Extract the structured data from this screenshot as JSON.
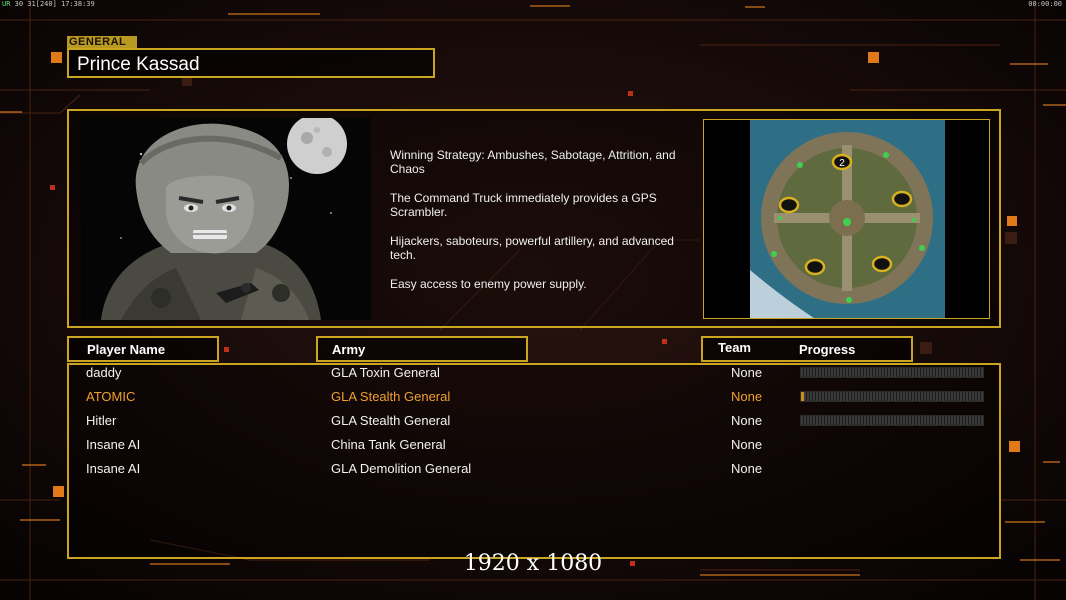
{
  "hud": {
    "left_prefix": "UR",
    "left_text": "30 31[240] 17:38:39",
    "right_text": "00:00:00"
  },
  "general": {
    "tag": "GENERAL",
    "name": "Prince Kassad",
    "description": [
      "Winning Strategy: Ambushes, Sabotage, Attrition, and Chaos",
      "The Command Truck immediately provides a GPS Scrambler.",
      "Hijackers, saboteurs, powerful artillery, and advanced tech.",
      "Easy access to enemy power supply."
    ]
  },
  "map": {
    "player_marker": "2"
  },
  "columns": {
    "player_name": "Player Name",
    "army": "Army",
    "team": "Team",
    "progress": "Progress"
  },
  "players": [
    {
      "name": "daddy",
      "army": "GLA Toxin General",
      "team": "None",
      "progress": 0.0,
      "show_bar": true,
      "highlight": false
    },
    {
      "name": "ATOMIC",
      "army": "GLA Stealth General",
      "team": "None",
      "progress": 0.01,
      "show_bar": true,
      "highlight": true
    },
    {
      "name": "Hitler",
      "army": "GLA Stealth General",
      "team": "None",
      "progress": 0.0,
      "show_bar": true,
      "highlight": false
    },
    {
      "name": "Insane AI",
      "army": "China Tank General",
      "team": "None",
      "progress": 0.0,
      "show_bar": false,
      "highlight": false
    },
    {
      "name": "Insane AI",
      "army": "GLA Demolition General",
      "team": "None",
      "progress": 0.0,
      "show_bar": false,
      "highlight": false
    }
  ],
  "resolution_label": "1920 x 1080",
  "colors": {
    "frame": "#c9a521",
    "highlight_text": "#f0a030",
    "progress_fill": "#c8901a"
  }
}
